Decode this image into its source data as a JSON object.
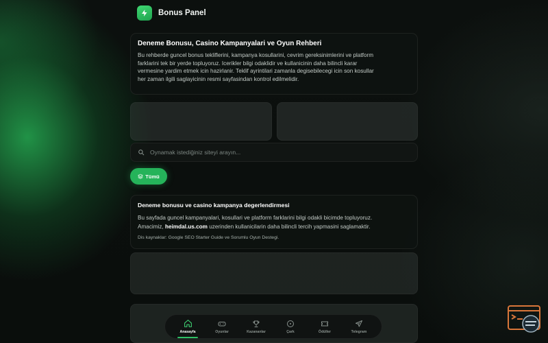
{
  "brand": {
    "name": "Bonus Panel",
    "icon": "bolt-icon"
  },
  "intro": {
    "title": "Deneme Bonusu, Casino Kampanyalari ve Oyun Rehberi",
    "line1": "Bu rehberde guncel bonus tekliflerini, kampanya kosullarini, cevrim gereksinimlerini ve platform",
    "line2": "farklarini tek bir yerde topluyoruz. Icerikler bilgi odaklidir ve kullanicinin daha bilincli karar",
    "line3": "vermesine yardim etmek icin hazirlanir. Teklif ayrintilari zamanla degisebilecegi icin son kosullar",
    "line4": "her zaman ilgili saglayicinin resmi sayfasindan kontrol edilmelidir."
  },
  "search": {
    "placeholder": "Oynamak istediğiniz siteyi arayın..."
  },
  "filter": {
    "label": "Tümü"
  },
  "evaluation": {
    "title": "Deneme bonusu ve casino kampanya degerlendirmesi",
    "line1": "Bu sayfada guncel kampanyalari, kosullari ve platform farklarini bilgi odakli bicimde topluyoruz.",
    "line2_pre": "Amacimiz, ",
    "line2_bold": "heimdal.us.com",
    "line2_post": " uzerinden kullanicilarin daha bilincli tercih yapmasini saglamaktir.",
    "sources": "Dis kaynaklar: Google SEO Starter Guide ve Sorumlu Oyun Destegi."
  },
  "nav": {
    "items": [
      {
        "label": "Anasayfa",
        "icon": "home-icon",
        "active": true
      },
      {
        "label": "Oyunlar",
        "icon": "gamepad-icon",
        "active": false
      },
      {
        "label": "Kazananlar",
        "icon": "trophy-icon",
        "active": false
      },
      {
        "label": "Çark",
        "icon": "wheel-icon",
        "active": false
      },
      {
        "label": "Ödüller",
        "icon": "ticket-icon",
        "active": false
      },
      {
        "label": "Telegram",
        "icon": "telegram-icon",
        "active": false
      }
    ]
  },
  "colors": {
    "accent": "#25b35a",
    "background": "#0a0d0c",
    "card": "#0e1210"
  }
}
